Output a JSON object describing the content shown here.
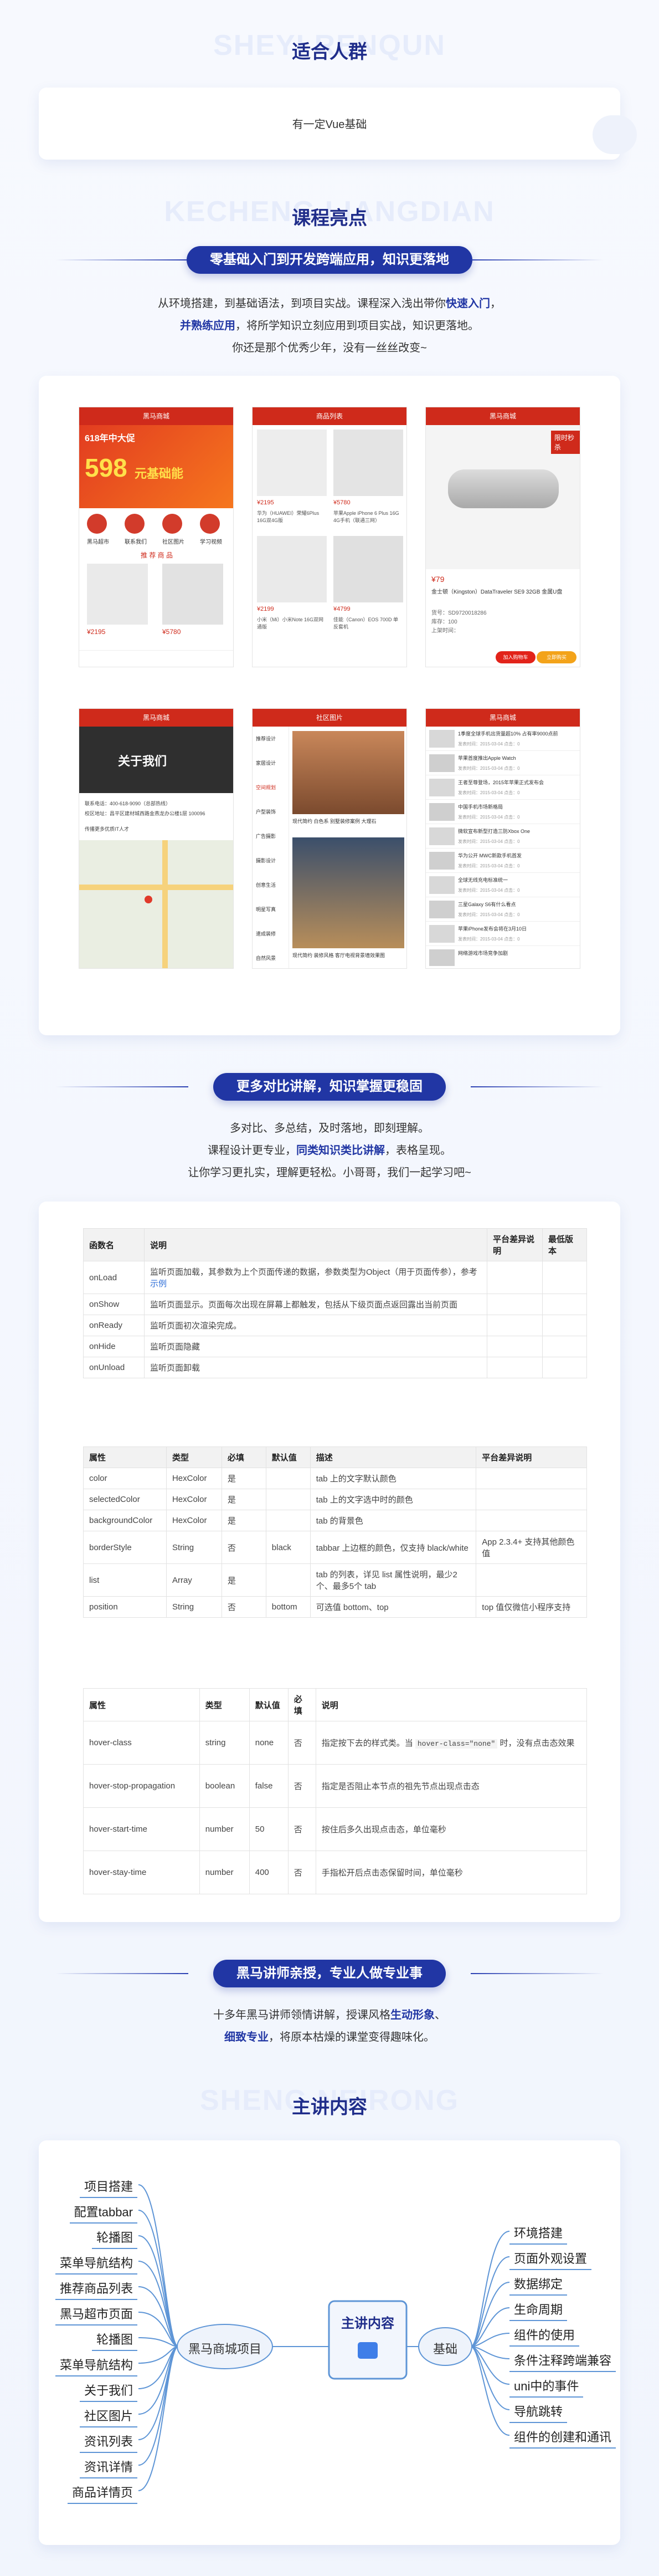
{
  "audience": {
    "ghost": "SHEYI RENQUN",
    "title": "适合人群",
    "text": "有一定Vue基础"
  },
  "highlights": {
    "ghost": "KECHENG LIANGDIAN",
    "title": "课程亮点",
    "pill": "零基础入门到开发跨端应用，知识更落地",
    "line1_pre": "从环境搭建，到基础语法，到项目实战。课程深入浅出带你",
    "line1_hl": "快速入门",
    "line1_post": "，",
    "line2_hl": "并熟练应用",
    "line2_post": "，将所学知识立刻应用到项目实战，知识更落地。",
    "line3": "你还是那个优秀少年，没有一丝丝改变~"
  },
  "screens": {
    "app_name": "黑马商城",
    "goods_list": "商品列表",
    "about_us": "关于我们",
    "community": "社区图片",
    "news": "黑马商城",
    "banner_text": "618年中大促",
    "banner_price": "598",
    "banner_unit": "元基础能",
    "nav": [
      "黑马超市",
      "联系我们",
      "社区图片",
      "学习视频"
    ],
    "recommend": "推 荐 商 品",
    "prices": [
      "¥2195",
      "¥5780",
      "¥2195",
      "¥5780"
    ],
    "list_prices": [
      "¥2195",
      "¥5780",
      "¥2199",
      "¥4799"
    ],
    "list_desc": [
      "华为（HUAWEI）荣耀6Plus 16G双4G版",
      "苹果Apple iPhone 6 Plus 16G 4G手机（联通三网）",
      "小米（Mi）小米Note 16G双网通版",
      "佳能（Canon）EOS 700D 单反套机"
    ],
    "detail_price": "¥79",
    "detail_title": "金士顿（Kingston）DataTraveler SE9 32GB 金属U盘",
    "detail_meta": [
      "货号：SD9720018286",
      "库存：100",
      "上架时间："
    ],
    "detail_buttons": [
      "加入购物车",
      "立即购买"
    ],
    "sale_tag": "限时秒杀",
    "about_title": "关于我们",
    "about_info": [
      "联系电话：400-618-9090（总部热线）",
      "校区地址：昌平区建材城西路金燕龙办公楼1层 100096",
      "传播更多优质IT人才"
    ],
    "community_tabs": [
      "推荐设计",
      "家居设计",
      "空间规划",
      "户型装饰",
      "广告摄影",
      "摄影设计",
      "创意生活",
      "明星写真",
      "速成装修",
      "自然风景"
    ],
    "community_caption": [
      "现代简约 白色系 别墅装修案例 大理石",
      "现代简约 装修风格 客厅电视背景墙效果图"
    ],
    "news_items": [
      "1季度全球手机出货量超10% 占有率9000点前",
      "苹果首度推出Apple Watch",
      "王者至尊登场，2015年苹果正式发布会",
      "中国手机市场新格局",
      "微软宣布新型打造三防Xbox One",
      "华为公开 MWC新款手机首发",
      "全球无线充电标准统一",
      "三星Galaxy S6有什么看点",
      "苹果iPhone发布会将在3月10日",
      "网络游戏市场竞争加剧"
    ],
    "news_meta": "发表时间：2015-03-04  点击：0"
  },
  "compare": {
    "pill": "更多对比讲解，知识掌握更稳固",
    "line1": "多对比、多总结，及时落地，即刻理解。",
    "line2_pre": "课程设计更专业，",
    "line2_hl": "同类知识类比讲解",
    "line2_post": "，表格呈现。",
    "line3": "让你学习更扎实，理解更轻松。小哥哥，我们一起学习吧~",
    "table1": {
      "headers": [
        "函数名",
        "说明",
        "平台差异说明",
        "最低版本"
      ],
      "rows": [
        [
          "onLoad",
          "监听页面加载，其参数为上个页面传递的数据，参数类型为Object（用于页面传参），参考",
          "示例",
          "",
          ""
        ],
        [
          "onShow",
          "监听页面显示。页面每次出现在屏幕上都触发，包括从下级页面点返回露出当前页面",
          "",
          "",
          ""
        ],
        [
          "onReady",
          "监听页面初次渲染完成。",
          "",
          "",
          ""
        ],
        [
          "onHide",
          "监听页面隐藏",
          "",
          "",
          ""
        ],
        [
          "onUnload",
          "监听页面卸载",
          "",
          "",
          ""
        ]
      ]
    },
    "table2": {
      "headers": [
        "属性",
        "类型",
        "必填",
        "默认值",
        "描述",
        "平台差异说明"
      ],
      "rows": [
        [
          "color",
          "HexColor",
          "是",
          "",
          "tab 上的文字默认颜色",
          ""
        ],
        [
          "selectedColor",
          "HexColor",
          "是",
          "",
          "tab 上的文字选中时的颜色",
          ""
        ],
        [
          "backgroundColor",
          "HexColor",
          "是",
          "",
          "tab 的背景色",
          ""
        ],
        [
          "borderStyle",
          "String",
          "否",
          "black",
          "tabbar 上边框的颜色，仅支持 black/white",
          "App 2.3.4+ 支持其他颜色值"
        ],
        [
          "list",
          "Array",
          "是",
          "",
          "tab 的列表，详见 list 属性说明，最少2个、最多5个 tab",
          ""
        ],
        [
          "position",
          "String",
          "否",
          "bottom",
          "可选值 bottom、top",
          "top 值仅微信小程序支持"
        ]
      ]
    },
    "table3": {
      "headers": [
        "属性",
        "类型",
        "默认值",
        "必填",
        "说明"
      ],
      "rows": [
        [
          "hover-class",
          "string",
          "none",
          "否",
          "指定按下去的样式类。当",
          "hover-class=\"none\"",
          "时，没有点击态效果"
        ],
        [
          "hover-stop-propagation",
          "boolean",
          "false",
          "否",
          "指定是否阻止本节点的祖先节点出现点击态",
          "",
          ""
        ],
        [
          "hover-start-time",
          "number",
          "50",
          "否",
          "按住后多久出现点击态，单位毫秒",
          "",
          ""
        ],
        [
          "hover-stay-time",
          "number",
          "400",
          "否",
          "手指松开后点击态保留时间，单位毫秒",
          "",
          ""
        ]
      ]
    }
  },
  "teacher": {
    "pill": "黑马讲师亲授，专业人做专业事",
    "line1_pre": "十多年黑马讲师领情讲解，授课风格",
    "line1_hl": "生动形象",
    "line1_post": "、",
    "line2_hl": "细致专业",
    "line2_post": "，将原本枯燥的课堂变得趣味化。"
  },
  "content": {
    "ghost": "SHENG NEIRONG",
    "title": "主讲内容",
    "center": "主讲内容",
    "left_hub": "黑马商城项目",
    "right_hub": "基础",
    "left_items": [
      "项目搭建",
      "配置tabbar",
      "轮播图",
      "菜单导航结构",
      "推荐商品列表",
      "黑马超市页面",
      "轮播图",
      "菜单导航结构",
      "关于我们",
      "社区图片",
      "资讯列表",
      "资讯详情",
      "商品详情页"
    ],
    "right_items": [
      "环境搭建",
      "页面外观设置",
      "数据绑定",
      "生命周期",
      "组件的使用",
      "条件注释跨端兼容",
      "uni中的事件",
      "导航跳转",
      "组件的创建和通讯"
    ]
  },
  "colors": {
    "brand": "#2136a4",
    "title": "#1f2d8a",
    "app_red": "#cf2a1b",
    "mind_line": "#5e95d6"
  }
}
